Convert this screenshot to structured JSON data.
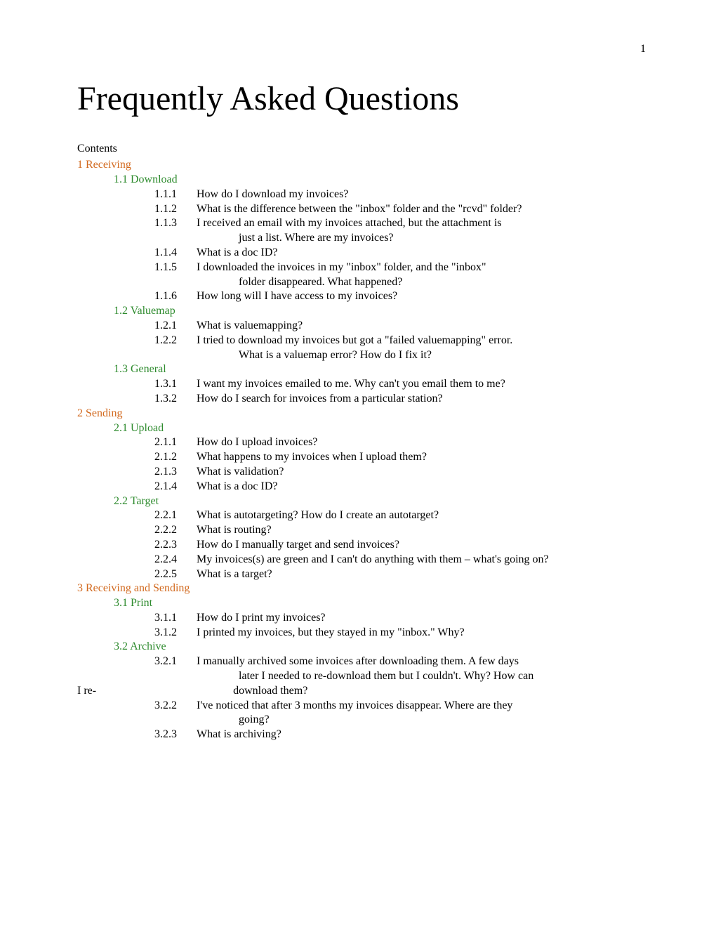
{
  "page_number": "1",
  "title": "Frequently Asked Questions",
  "contents_label": "Contents",
  "toc": {
    "s1": {
      "label": "1 Receiving",
      "s1_1": {
        "label": "1.1 Download",
        "items": [
          {
            "num": "1.1.1",
            "text": "How do I download my invoices?"
          },
          {
            "num": "1.1.2",
            "text": "What is the difference between the \"inbox\" folder and the \"rcvd\" folder?"
          },
          {
            "num": "1.1.3",
            "text": "I received an email with my invoices attached, but the attachment is",
            "cont": "just a list. Where are my invoices?"
          },
          {
            "num": "1.1.4",
            "text": "What is a doc ID?"
          },
          {
            "num": "1.1.5",
            "text": "I downloaded the invoices in my \"inbox\" folder, and the \"inbox\"",
            "cont": "folder disappeared. What happened?"
          },
          {
            "num": "1.1.6",
            "text": "How long will I have access to my invoices?"
          }
        ]
      },
      "s1_2": {
        "label": "1.2 Valuemap",
        "items": [
          {
            "num": "1.2.1",
            "text": "What is valuemapping?"
          },
          {
            "num": "1.2.2",
            "text": "I tried to download my invoices but got a \"failed valuemapping\" error.",
            "cont": "What is a valuemap error? How do I fix it?"
          }
        ]
      },
      "s1_3": {
        "label": "1.3 General",
        "items": [
          {
            "num": "1.3.1",
            "text": "I want my invoices emailed to me.  Why can't you email them to me?"
          },
          {
            "num": "1.3.2",
            "text": "How do I search for invoices from a particular station?"
          }
        ]
      }
    },
    "s2": {
      "label": "2 Sending",
      "s2_1": {
        "label": "2.1 Upload",
        "items": [
          {
            "num": "2.1.1",
            "text": "How do I upload invoices?"
          },
          {
            "num": "2.1.2",
            "text": "What happens to my invoices when I upload them?"
          },
          {
            "num": "2.1.3",
            "text": "What is validation?"
          },
          {
            "num": "2.1.4",
            "text": "What is a doc ID?"
          }
        ]
      },
      "s2_2": {
        "label": "2.2 Target",
        "items": [
          {
            "num": "2.2.1",
            "text": "What is autotargeting? How do I create an autotarget?"
          },
          {
            "num": "2.2.2",
            "text": "What is routing?"
          },
          {
            "num": "2.2.3",
            "text": "How do I manually target and send invoices?"
          },
          {
            "num": "2.2.4",
            "text": "My invoices(s) are green and I can't do anything with them – what's going on?"
          },
          {
            "num": "2.2.5",
            "text": "What is a target?"
          }
        ]
      }
    },
    "s3": {
      "label": "3 Receiving and Sending",
      "s3_1": {
        "label": "3.1 Print",
        "items": [
          {
            "num": "3.1.1",
            "text": "How do I print my invoices?"
          },
          {
            "num": "3.1.2",
            "text": "I printed my invoices, but they stayed in my \"inbox.\"  Why?"
          }
        ]
      },
      "s3_2": {
        "label": "3.2 Archive",
        "items": [
          {
            "num": "3.2.1",
            "text": "I manually archived some invoices after downloading them.  A few days",
            "cont": "later I needed to re-download them but I couldn't.  Why? How can",
            "cont2_prefix": "I re-",
            "cont2": "download them?"
          },
          {
            "num": "3.2.2",
            "text": "I've noticed that after 3 months my invoices disappear.  Where are they",
            "cont": "going?"
          },
          {
            "num": "3.2.3",
            "text": "What is archiving?"
          }
        ]
      }
    }
  }
}
